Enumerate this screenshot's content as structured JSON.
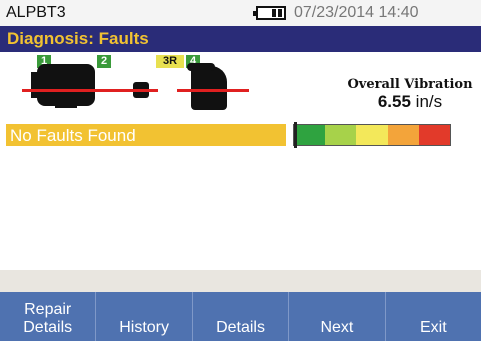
{
  "status_bar": {
    "device_name": "ALPBT3",
    "datetime": "07/23/2014 14:40"
  },
  "title": "Diagnosis: Faults",
  "diagram": {
    "tags": [
      "1",
      "2",
      "3R",
      "4"
    ]
  },
  "vibration": {
    "label": "Overall Vibration",
    "value": "6.55",
    "unit": "in/s"
  },
  "result": {
    "text": "No Faults Found"
  },
  "severity_scale": {
    "colors": [
      "#2fa340",
      "#a7d24a",
      "#f3e85a",
      "#f3a43a",
      "#e23a2a"
    ],
    "level_fraction": 0.0
  },
  "softkeys": [
    {
      "line1": "Repair",
      "line2": "Details"
    },
    {
      "line1": "",
      "line2": "History"
    },
    {
      "line1": "",
      "line2": "Details"
    },
    {
      "line1": "",
      "line2": "Next"
    },
    {
      "line1": "",
      "line2": "Exit"
    }
  ]
}
